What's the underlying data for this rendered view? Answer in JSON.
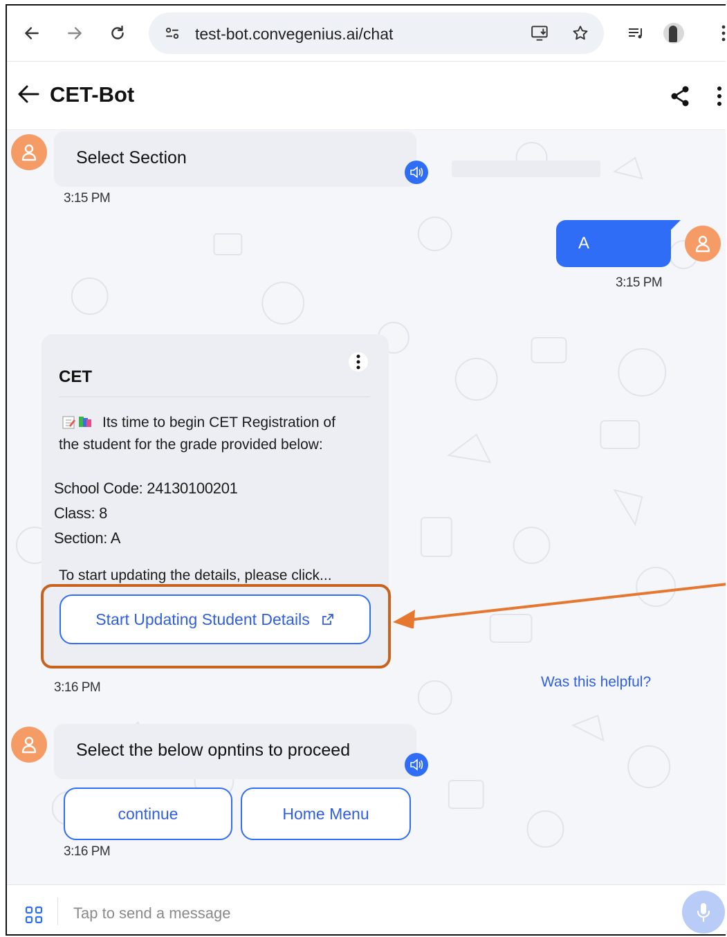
{
  "browser": {
    "url": "test-bot.convegenius.ai/chat"
  },
  "header": {
    "title": "CET-Bot"
  },
  "messages": {
    "bot1": {
      "text": "Select Section",
      "time": "3:15 PM"
    },
    "user1": {
      "text": "A",
      "time": "3:15 PM"
    },
    "card": {
      "title": "CET",
      "intro_line1": "Its time to begin CET Registration of",
      "intro_line2": "the student for the grade provided below:",
      "school_code": "School Code: 24130100201",
      "class": "Class: 8",
      "section": "Section: A",
      "cta_text": "To start updating the details, please click...",
      "button_label": "Start Updating Student Details",
      "time": "3:16 PM",
      "feedback_link": "Was this helpful?"
    },
    "bot2": {
      "text": "Select the below opntins to proceed",
      "options": [
        "continue",
        "Home Menu"
      ],
      "time": "3:16 PM"
    }
  },
  "composer": {
    "placeholder": "Tap to send a message"
  },
  "colors": {
    "accent": "#2f6df6",
    "avatar": "#f59b66",
    "highlight": "#c8621f"
  }
}
